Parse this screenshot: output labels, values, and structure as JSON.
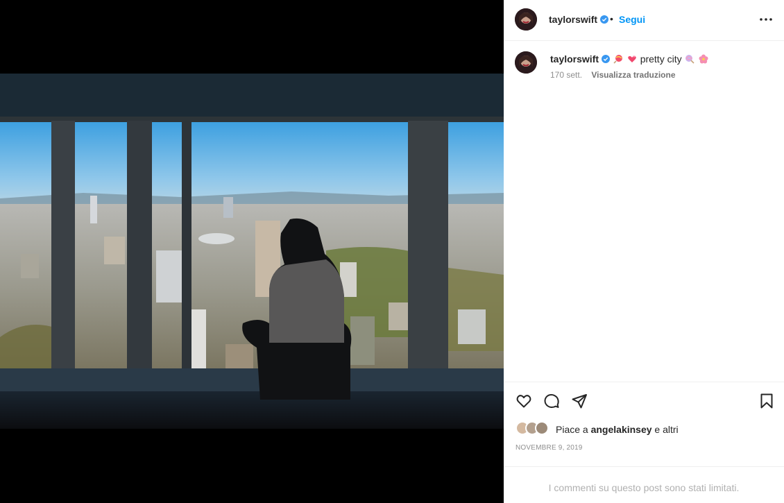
{
  "post": {
    "username": "taylorswift",
    "separator": "•",
    "follow_label": "Segui",
    "more_icon": "more-horizontal-icon",
    "verified_icon": "verified-badge-icon",
    "caption_text": "pretty city",
    "caption_emojis_before": [
      "lollipop-emoji",
      "two-hearts-emoji"
    ],
    "caption_emojis_after": [
      "lollipop-emoji",
      "cherry-blossom-emoji"
    ],
    "time_ago": "170 sett.",
    "translate_label": "Visualizza traduzione",
    "likes_prefix": "Piace a ",
    "likes_user": "angelakinsey",
    "likes_suffix": " e altri",
    "date": "NOVEMBRE 9, 2019",
    "comments_limited": "I commenti su questo post sono stati limitati."
  },
  "icons": {
    "like": "heart-icon",
    "comment": "comment-icon",
    "share": "paper-plane-icon",
    "save": "bookmark-icon"
  },
  "colors": {
    "link_blue": "#0095f6",
    "verified_blue": "#3897f0",
    "text": "#262626",
    "muted": "#8e8e8e"
  }
}
